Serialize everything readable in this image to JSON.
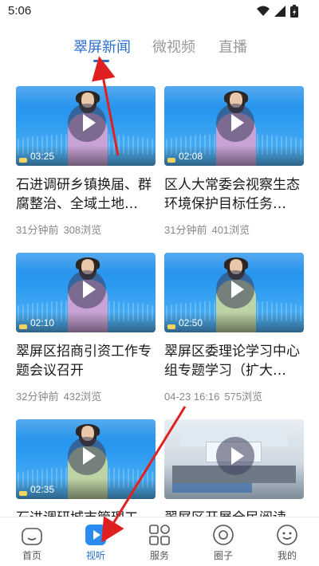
{
  "status_bar": {
    "time": "5:06",
    "icons": [
      "wifi-icon",
      "signal-icon",
      "battery-icon"
    ]
  },
  "tabs": [
    {
      "label": "翠屏新闻",
      "active": true
    },
    {
      "label": "微视频",
      "active": false
    },
    {
      "label": "直播",
      "active": false
    }
  ],
  "videos": [
    {
      "title": "石进调研乡镇换届、群腐整治、全域土地…",
      "time": "31分钟前",
      "views": "308浏览",
      "duration": "03:25"
    },
    {
      "title": "区人大常委会视察生态环境保护目标任务…",
      "time": "31分钟前",
      "views": "401浏览",
      "duration": "02:08"
    },
    {
      "title": "翠屏区招商引资工作专题会议召开",
      "time": "32分钟前",
      "views": "432浏览",
      "duration": "02:10"
    },
    {
      "title": "翠屏区委理论学习中心组专题学习（扩大…",
      "time": "04-23 16:16",
      "views": "575浏览",
      "duration": "02:50"
    },
    {
      "title": "石进调研城市管理工…",
      "time": "",
      "views": "",
      "duration": "02:35"
    },
    {
      "title": "翠屏区开展全民阅读…",
      "time": "",
      "views": "",
      "duration": ""
    }
  ],
  "bottom_nav": [
    {
      "label": "首页",
      "icon": "home-icon",
      "active": false
    },
    {
      "label": "视听",
      "icon": "play-icon",
      "active": true
    },
    {
      "label": "服务",
      "icon": "grid-icon",
      "active": false
    },
    {
      "label": "圈子",
      "icon": "circle-icon",
      "active": false
    },
    {
      "label": "我的",
      "icon": "face-icon",
      "active": false
    }
  ],
  "colors": {
    "accent": "#2a6fc9",
    "annotation_arrow": "#e02020"
  }
}
